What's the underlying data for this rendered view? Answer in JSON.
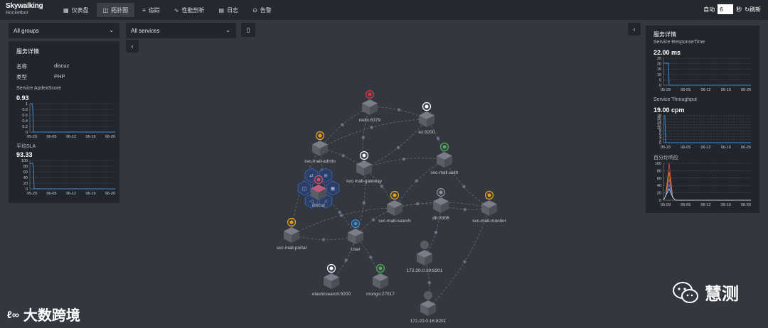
{
  "header": {
    "logo_title": "Skywalking",
    "logo_subtitle": "Rocketbot",
    "nav": [
      {
        "label": "仪表盘",
        "icon": "dashboard-icon",
        "glyph": "▦"
      },
      {
        "label": "拓扑图",
        "icon": "topology-icon",
        "glyph": "◫"
      },
      {
        "label": "追踪",
        "icon": "trace-icon",
        "glyph": "≡"
      },
      {
        "label": "性能剖析",
        "icon": "profile-icon",
        "glyph": "∿"
      },
      {
        "label": "日志",
        "icon": "log-icon",
        "glyph": "▤"
      },
      {
        "label": "告警",
        "icon": "alarm-icon",
        "glyph": "⊙"
      }
    ],
    "auto_label": "自动",
    "auto_value": "6",
    "seconds_label": "秒",
    "refresh_label": "刷新"
  },
  "filters": {
    "group_select": "All groups",
    "service_select": "All services"
  },
  "left_panel": {
    "title": "服务详情",
    "name_label": "名称",
    "name_value": "discuz",
    "type_label": "类型",
    "type_value": "PHP",
    "apdex_label": "Service ApdexScore",
    "apdex_value": "0.93",
    "apdex_yticks": [
      "1",
      "0.8",
      "0.6",
      "0.4",
      "0.2",
      "0"
    ],
    "sla_label": "平均SLA",
    "sla_value": "93.33",
    "sla_yticks": [
      "100",
      "80",
      "60",
      "40",
      "20",
      "0"
    ],
    "xticks": [
      "05-29",
      "06-05",
      "06-12",
      "06-19",
      "06-26"
    ]
  },
  "right_panel": {
    "title": "服务详情",
    "rt_label": "Service ResponseTime",
    "rt_value": "22.00 ms",
    "rt_yticks": [
      "25",
      "20",
      "15",
      "10",
      "5",
      "0"
    ],
    "tp_label": "Service Throughput",
    "tp_value": "19.00 cpm",
    "tp_yticks": [
      "18",
      "16",
      "14",
      "12",
      "10",
      "8",
      "6",
      "4",
      "2",
      "0"
    ],
    "pct_label": "百分比响应",
    "pct_yticks": [
      "100",
      "80",
      "60",
      "40",
      "20",
      "0"
    ],
    "xticks": [
      "05-29",
      "06-05",
      "06-12",
      "06-19",
      "06-26"
    ]
  },
  "topology": {
    "nodes": [
      {
        "id": "redis",
        "label": "redis:6379",
        "badge": "redis-icon",
        "badge_color": "#d9343f"
      },
      {
        "id": "es",
        "label": "es:9200",
        "badge": "elasticsearch-icon",
        "badge_color": "#ffffff"
      },
      {
        "id": "admin",
        "label": "svc-mall-admin",
        "badge": "java-icon",
        "badge_color": "#e8a317"
      },
      {
        "id": "gateway",
        "label": "svc-mall-gateway",
        "badge": "info-icon",
        "badge_color": "#ffffff"
      },
      {
        "id": "auth",
        "label": "svc-mall-auth",
        "badge": "go-icon",
        "badge_color": "#4caf50"
      },
      {
        "id": "discuz",
        "label": "discuz",
        "badge": "php-icon",
        "badge_color": "#d14f7a"
      },
      {
        "id": "search",
        "label": "svc-mall-search",
        "badge": "java-icon",
        "badge_color": "#e8a317"
      },
      {
        "id": "db",
        "label": "db:3306",
        "badge": "mysql-icon",
        "badge_color": "#8a8f99"
      },
      {
        "id": "monitor",
        "label": "svc-mall-monitor",
        "badge": "java-icon",
        "badge_color": "#e8a317"
      },
      {
        "id": "portal",
        "label": "svc-mall-portal",
        "badge": "java-icon",
        "badge_color": "#e8a317"
      },
      {
        "id": "user",
        "label": "User",
        "badge": "user-icon",
        "badge_color": "#3a8fd9"
      },
      {
        "id": "ip19",
        "label": "172.20.0.19:8201",
        "badge": "none",
        "badge_color": "#6b6f78"
      },
      {
        "id": "elasticsearch",
        "label": "elasticsearch:9200",
        "badge": "elasticsearch-icon",
        "badge_color": "#ffffff"
      },
      {
        "id": "mongo",
        "label": "mongo:27017",
        "badge": "mongo-icon",
        "badge_color": "#4caf50"
      },
      {
        "id": "ip16",
        "label": "172.20.0.16:8201",
        "badge": "none",
        "badge_color": "#6b6f78"
      }
    ]
  },
  "watermark": {
    "left_text": "大数跨境",
    "right_text": "慧测"
  }
}
